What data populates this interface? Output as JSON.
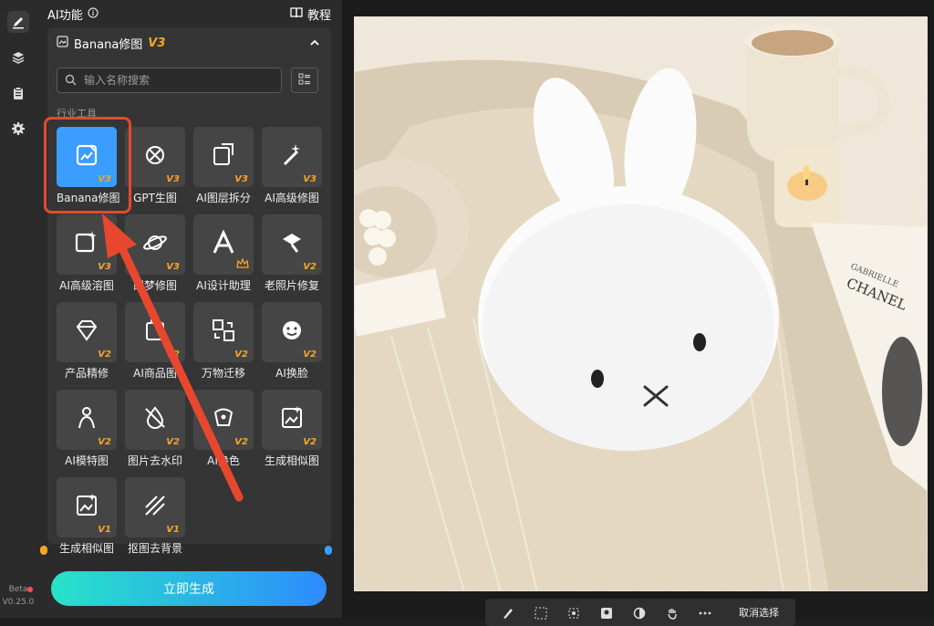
{
  "rail": {
    "version_label": "Beta",
    "version": "V0.25.0"
  },
  "panel": {
    "title": "AI功能",
    "tutorial": "教程",
    "section": {
      "name": "Banana修图",
      "version": "V3"
    },
    "search": {
      "placeholder": "输入名称搜索"
    },
    "category": "行业工具",
    "tools": [
      {
        "label": "Banana修图",
        "badge": "V3",
        "icon": "image-edit-icon"
      },
      {
        "label": "GPT生图",
        "badge": "V3",
        "icon": "gpt-icon"
      },
      {
        "label": "AI图层拆分",
        "badge": "V3",
        "icon": "layer-split-icon"
      },
      {
        "label": "AI高级修图",
        "badge": "V3",
        "icon": "magic-wand-icon"
      },
      {
        "label": "AI高级溶图",
        "badge": "V3",
        "icon": "image-blend-icon"
      },
      {
        "label": "即梦修图",
        "badge": "V3",
        "icon": "planet-icon"
      },
      {
        "label": "AI设计助理",
        "badge": "",
        "icon": "design-assistant-icon"
      },
      {
        "label": "老照片修复",
        "badge": "V2",
        "icon": "photo-repair-icon"
      },
      {
        "label": "产品精修",
        "badge": "V2",
        "icon": "diamond-icon"
      },
      {
        "label": "AI商品图",
        "badge": "V2",
        "icon": "product-image-icon"
      },
      {
        "label": "万物迁移",
        "badge": "V2",
        "icon": "transfer-icon"
      },
      {
        "label": "AI换脸",
        "badge": "V2",
        "icon": "face-swap-icon"
      },
      {
        "label": "AI模特图",
        "badge": "V2",
        "icon": "model-icon"
      },
      {
        "label": "图片去水印",
        "badge": "V2",
        "icon": "watermark-remove-icon"
      },
      {
        "label": "AI换色",
        "badge": "V2",
        "icon": "recolor-icon"
      },
      {
        "label": "生成相似图",
        "badge": "V2",
        "icon": "similar-image-icon"
      },
      {
        "label": "生成相似图",
        "badge": "V1",
        "icon": "similar-image-icon"
      },
      {
        "label": "抠图去背景",
        "badge": "V1",
        "icon": "remove-bg-icon"
      }
    ],
    "generate_button": "立即生成"
  },
  "canvas": {
    "toolbar": {
      "cancel_label": "取消选择"
    },
    "photo_text": {
      "magazine_brand": "CHANEL",
      "magazine_top": "GABRIELLE"
    }
  },
  "colors": {
    "accent_blue": "#3a9dff",
    "badge_orange": "#f5a623",
    "annotation_red": "#e8472f"
  }
}
